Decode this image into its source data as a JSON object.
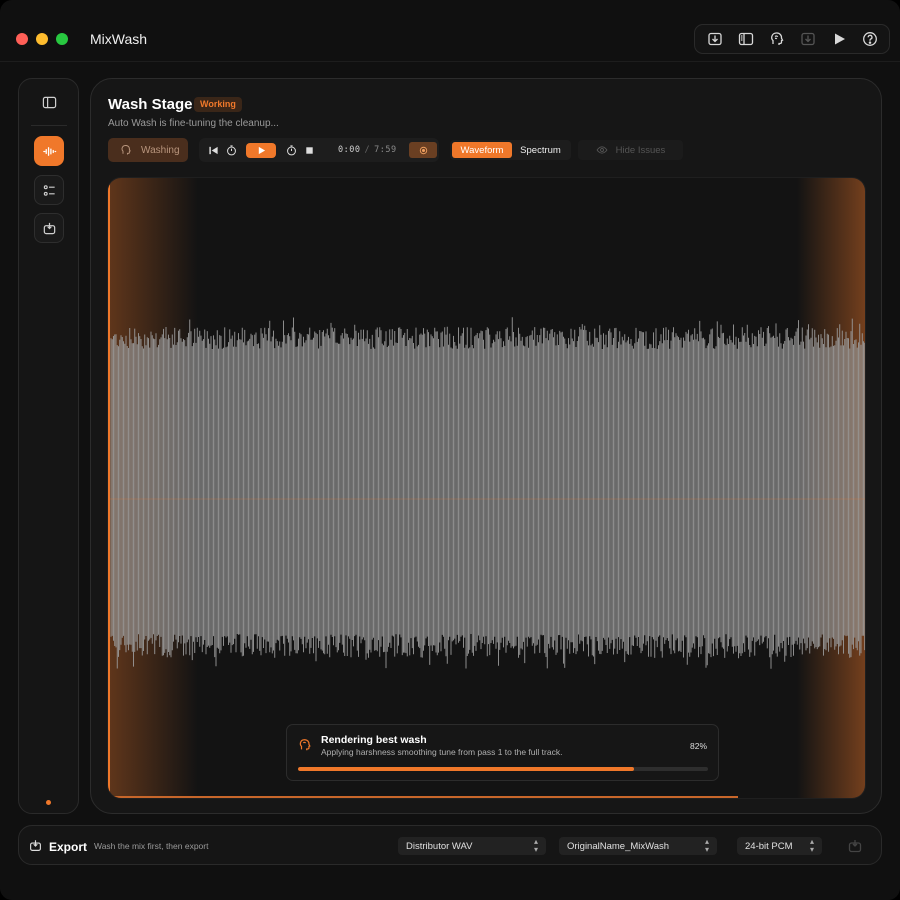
{
  "app": {
    "title": "MixWash"
  },
  "titlebar": {
    "tools": [
      {
        "name": "import-icon",
        "enabled": true
      },
      {
        "name": "sidebar-toggle-icon",
        "enabled": true
      },
      {
        "name": "listen-head-icon",
        "enabled": true
      },
      {
        "name": "export-arrow-icon",
        "enabled": false
      },
      {
        "name": "play-icon",
        "enabled": true
      },
      {
        "name": "help-icon",
        "enabled": true
      }
    ]
  },
  "sidebar": {
    "items": [
      {
        "name": "panel-toggle-icon"
      },
      {
        "name": "waveform-icon",
        "active": true
      },
      {
        "name": "settings-list-icon"
      },
      {
        "name": "export-icon"
      }
    ]
  },
  "stage": {
    "title": "Wash Stage",
    "badge": "Working",
    "subtitle": "Auto Wash is fine-tuning the cleanup...",
    "washing_label": "Washing",
    "time_current": "0:00",
    "time_separator": "/",
    "time_total": "7:59",
    "view_tabs": [
      {
        "label": "Waveform",
        "active": true
      },
      {
        "label": "Spectrum",
        "active": false
      }
    ],
    "hide_issues_label": "Hide Issues"
  },
  "render": {
    "title": "Rendering best wash",
    "description": "Applying harshness smoothing tune from pass 1 to the full track.",
    "percent_label": "82%",
    "progress": 0.82
  },
  "playback": {
    "position_fraction": 0.83
  },
  "export": {
    "label": "Export",
    "hint": "Wash the mix first, then export",
    "format": "Distributor WAV",
    "filename": "OriginalName_MixWash",
    "bit_depth": "24-bit PCM"
  },
  "colors": {
    "accent": "#f0782a",
    "waveform": "#9a9a9a",
    "background": "#101010"
  }
}
